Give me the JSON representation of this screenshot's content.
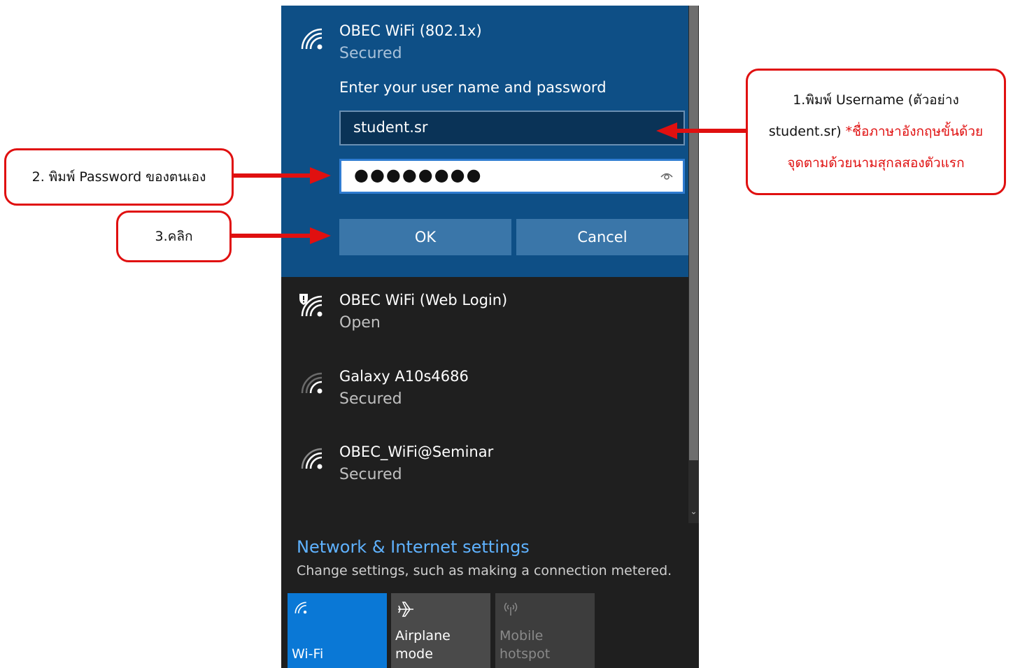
{
  "networks": {
    "selected": {
      "name": "OBEC WiFi (802.1x)",
      "status": "Secured",
      "prompt": "Enter your user name and password",
      "username_value": "student.sr",
      "password_mask": "●●●●●●●●",
      "ok_label": "OK",
      "cancel_label": "Cancel"
    },
    "list": [
      {
        "name": "OBEC WiFi (Web Login)",
        "status": "Open"
      },
      {
        "name": "Galaxy A10s4686",
        "status": "Secured"
      },
      {
        "name": "OBEC_WiFi@Seminar",
        "status": "Secured"
      }
    ]
  },
  "settings": {
    "title": "Network & Internet settings",
    "subtitle": "Change settings, such as making a connection metered."
  },
  "tiles": {
    "wifi": "Wi-Fi",
    "airplane": "Airplane mode",
    "hotspot_line1": "Mobile",
    "hotspot_line2": "hotspot"
  },
  "callouts": {
    "step1_line1": "1.พิมพ์ Username (ตัวอย่าง",
    "step1_line2_black": "student.sr) ",
    "step1_line2_red": "*ชื่อภาษาอังกฤษขั้นด้วย",
    "step1_line3_red": "จุดตามด้วยนามสุกลสองตัวแรก",
    "step2": "2. พิมพ์ Password ของตนเอง",
    "step3": "3.คลิก"
  },
  "colors": {
    "accent": "#0a78d6",
    "selected_bg": "#0e4f86",
    "panel_bg": "#1f1f1f",
    "callout_red": "#e01010",
    "link_blue": "#5fb2ff"
  }
}
